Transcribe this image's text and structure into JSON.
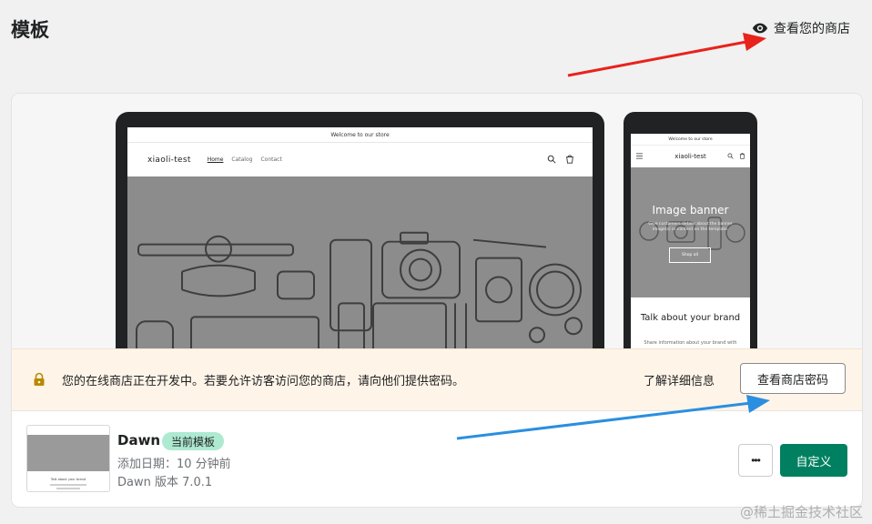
{
  "page": {
    "title": "模板",
    "view_store": "查看您的商店"
  },
  "preview": {
    "desktop": {
      "announcement": "Welcome to our store",
      "logo": "xiaoli-test",
      "nav": [
        "Home",
        "Catalog",
        "Contact"
      ]
    },
    "mobile": {
      "announcement": "Welcome to our store",
      "logo": "xiaoli-test",
      "banner_title": "Image banner",
      "banner_text": "Give customers details about the banner image(s) or content on the template.",
      "banner_button": "Shop all",
      "talk_title": "Talk about your brand",
      "talk_text": "Share information about your brand with"
    }
  },
  "notice": {
    "text": "您的在线商店正在开发中。若要允许访客访问您的商店，请向他们提供密码。",
    "learn_more": "了解详细信息",
    "button": "查看商店密码"
  },
  "theme": {
    "name": "Dawn",
    "badge": "当前模板",
    "added": "添加日期：10 分钟前",
    "version": "Dawn 版本 7.0.1",
    "thumb_caption": "Talk about your brand",
    "more_label": "•••",
    "customize": "自定义"
  },
  "watermark": "@稀土掘金技术社区",
  "colors": {
    "primary": "#008060",
    "badge": "#aee9d1",
    "notice_bg": "#fff4e8",
    "arrow_red": "#e8231b",
    "arrow_blue": "#2a8fe0"
  }
}
